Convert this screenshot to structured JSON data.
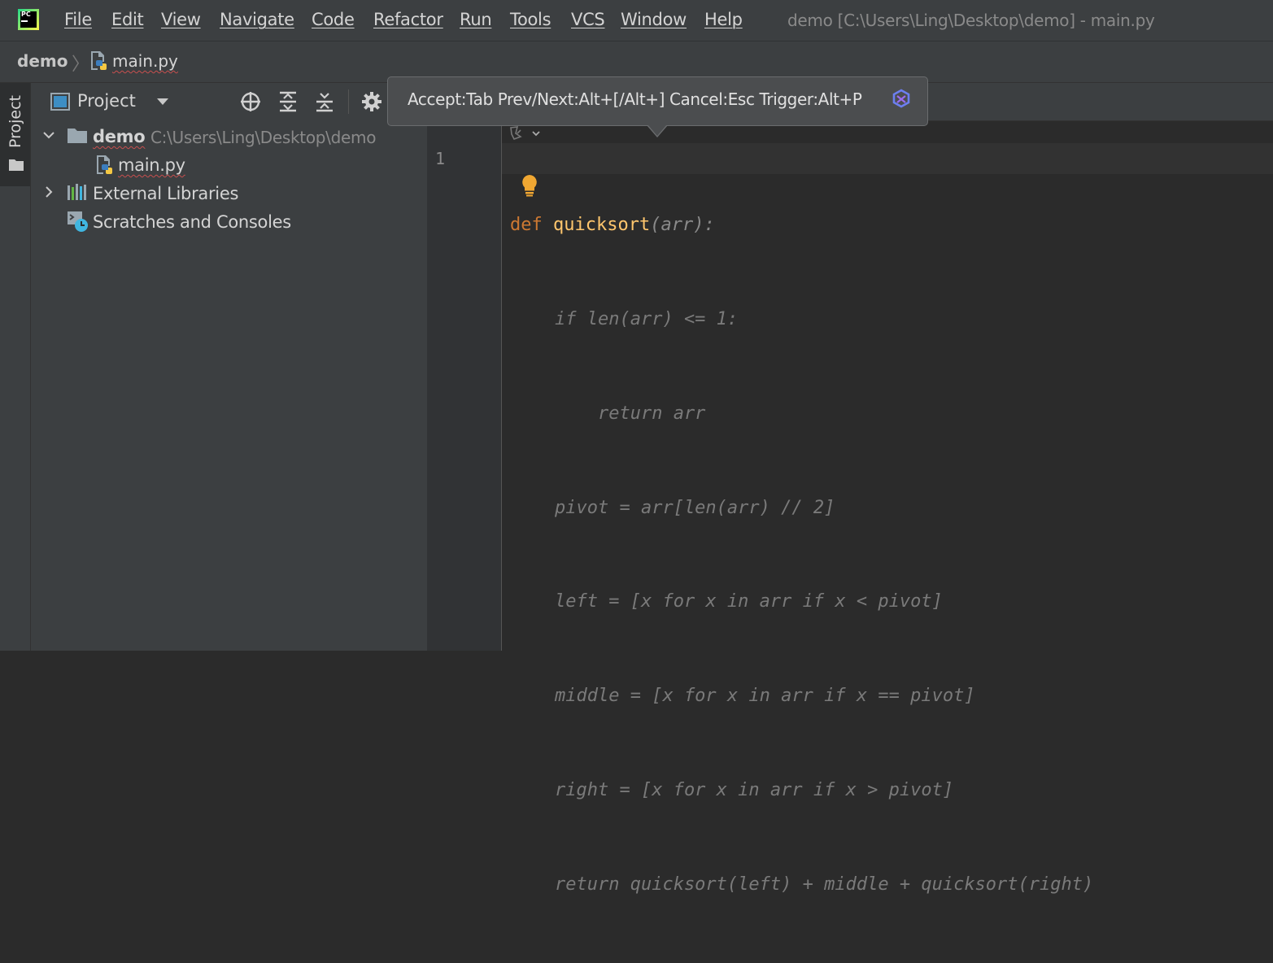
{
  "menubar": {
    "items": [
      {
        "label": "File"
      },
      {
        "label": "Edit"
      },
      {
        "label": "View"
      },
      {
        "label": "Navigate"
      },
      {
        "label": "Code"
      },
      {
        "label": "Refactor"
      },
      {
        "label": "Run"
      },
      {
        "label": "Tools"
      },
      {
        "label": "VCS"
      },
      {
        "label": "Window"
      },
      {
        "label": "Help"
      }
    ],
    "window_title": "demo [C:\\Users\\Ling\\Desktop\\demo] - main.py",
    "logo_text": "PC"
  },
  "breadcrumb": {
    "project": "demo",
    "file": "main.py"
  },
  "tool_stripe": {
    "project_label": "Project"
  },
  "project_panel": {
    "title": "Project",
    "tree": {
      "root": {
        "name": "demo",
        "path": "C:\\Users\\Ling\\Desktop\\demo"
      },
      "file": {
        "name": "main.py"
      },
      "external": {
        "name": "External Libraries"
      },
      "scratches": {
        "name": "Scratches and Consoles"
      }
    }
  },
  "editor": {
    "line_number": "1",
    "code": {
      "line1": {
        "kw": "def",
        "fn": "quicksort",
        "params": "(arr):"
      },
      "ghost": [
        "if len(arr) <= 1:",
        "    return arr",
        "pivot = arr[len(arr) // 2]",
        "left = [x for x in arr if x < pivot]",
        "middle = [x for x in arr if x == pivot]",
        "right = [x for x in arr if x > pivot]",
        "return quicksort(left) + middle + quicksort(right)"
      ]
    }
  },
  "tooltip": {
    "text": "Accept:Tab Prev/Next:Alt+[/Alt+] Cancel:Esc Trigger:Alt+P"
  },
  "colors": {
    "keyword": "#cc7832",
    "function": "#ffc66d",
    "ghost_text": "#7a7a7a",
    "panel_bg": "#3c3f41",
    "editor_bg": "#2b2b2b"
  }
}
